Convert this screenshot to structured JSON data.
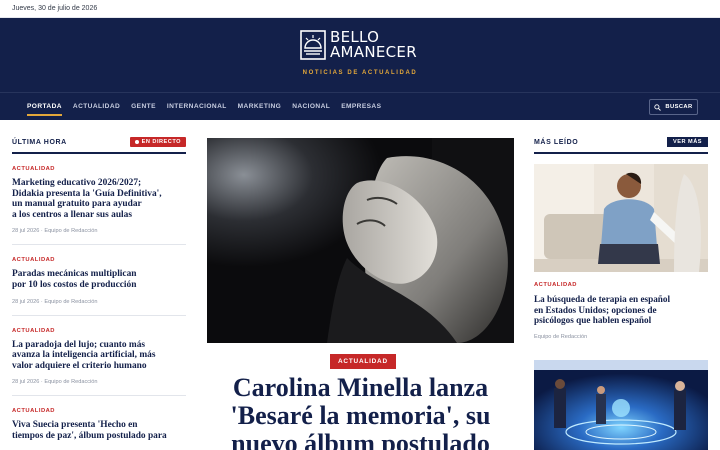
{
  "topbar": {
    "date": "Jueves, 30 de julio de 2026"
  },
  "brand": {
    "line1": "BELLO",
    "line2": "AMANECER",
    "tagline": "NOTICIAS DE ACTUALIDAD",
    "colors": {
      "navy": "#13204a",
      "accent": "#e3a73a",
      "red": "#c62828"
    }
  },
  "nav": {
    "items": [
      {
        "label": "PORTADA",
        "active": true
      },
      {
        "label": "ACTUALIDAD"
      },
      {
        "label": "GENTE"
      },
      {
        "label": "INTERNACIONAL"
      },
      {
        "label": "MARKETING"
      },
      {
        "label": "NACIONAL"
      },
      {
        "label": "EMPRESAS"
      }
    ],
    "search_label": "BUSCAR",
    "search_icon": "search-icon"
  },
  "left": {
    "title": "ÚLTIMA HORA",
    "live_label": "EN DIRECTO",
    "items": [
      {
        "category": "ACTUALIDAD",
        "lines": [
          "Marketing educativo 2026/2027;",
          "Didakia presenta la 'Guía Definitiva',",
          "un manual gratuito para ayudar",
          "a los centros a llenar sus aulas"
        ],
        "meta": "28 jul 2026 · Equipo de Redacción"
      },
      {
        "category": "ACTUALIDAD",
        "lines": [
          "Paradas mecánicas multiplican",
          "por 10 los costos de producción"
        ],
        "meta": "28 jul 2026 · Equipo de Redacción"
      },
      {
        "category": "ACTUALIDAD",
        "lines": [
          "La paradoja del lujo; cuanto más",
          "avanza la inteligencia artificial, más",
          "valor adquiere el criterio humano"
        ],
        "meta": "28 jul 2026 · Equipo de Redacción"
      },
      {
        "category": "ACTUALIDAD",
        "lines": [
          "Viva Suecia presenta 'Hecho en",
          "tiempos de paz', álbum postulado para"
        ],
        "meta": ""
      }
    ]
  },
  "hero": {
    "category": "ACTUALIDAD",
    "title_lines": [
      "Carolina Minella lanza",
      "'Besaré la memoria', su",
      "nuevo álbum postulado"
    ]
  },
  "right": {
    "title": "MÁS LEÍDO",
    "more_label": "VER MÁS",
    "item": {
      "category": "ACTUALIDAD",
      "lines": [
        "La búsqueda de terapia en español",
        "en Estados Unidos; opciones de",
        "psicólogos que hablen español"
      ],
      "meta": "Equipo de Redacción"
    }
  }
}
